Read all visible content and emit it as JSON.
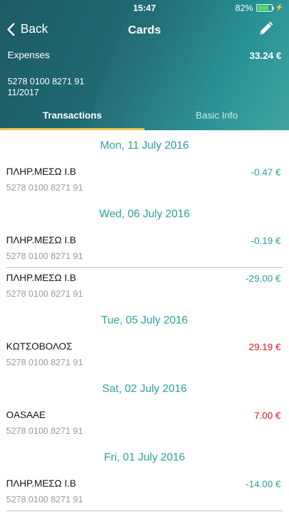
{
  "status": {
    "time": "15:47",
    "battery_pct": "82%",
    "battery_level": 0.82
  },
  "nav": {
    "back_label": "Back",
    "title": "Cards"
  },
  "card": {
    "name": "Expenses",
    "total": "33.24 €",
    "number": "5278 0100 8271 91",
    "expiry": "11/2017"
  },
  "tabs": [
    {
      "label": "Transactions",
      "active": true
    },
    {
      "label": "Basic Info",
      "active": false
    }
  ],
  "groups": [
    {
      "date": "Mon, 11 July 2016",
      "items": [
        {
          "name": "ΠΛΗΡ.ΜΕΣΩ Ι.Β",
          "card": "5278 0100 8271 91",
          "amount": "-0.47 €",
          "type": "debit"
        }
      ]
    },
    {
      "date": "Wed, 06 July 2016",
      "items": [
        {
          "name": "ΠΛΗΡ.ΜΕΣΩ Ι.Β",
          "card": "5278 0100 8271 91",
          "amount": "-0.19 €",
          "type": "debit"
        },
        {
          "name": "ΠΛΗΡ.ΜΕΣΩ Ι.Β",
          "card": "5278 0100 8271 91",
          "amount": "-29.00 €",
          "type": "debit"
        }
      ]
    },
    {
      "date": "Tue, 05 July 2016",
      "items": [
        {
          "name": "ΚΩΤΣΟΒΟΛΟΣ",
          "card": "5278 0100 8271 91",
          "amount": "29.19 €",
          "type": "credit"
        }
      ]
    },
    {
      "date": "Sat, 02 July 2016",
      "items": [
        {
          "name": "OASAAE",
          "card": "5278 0100 8271 91",
          "amount": "7.00 €",
          "type": "credit"
        }
      ]
    },
    {
      "date": "Fri, 01 July 2016",
      "items": [
        {
          "name": "ΠΛΗΡ.ΜΕΣΩ Ι.Β",
          "card": "5278 0100 8271 91",
          "amount": "-14.00 €",
          "type": "debit"
        }
      ]
    }
  ],
  "icons": {
    "back": "chevron-left-icon",
    "edit": "pencil-icon"
  },
  "colors": {
    "accent": "#2aa19b",
    "credit": "#e0121a",
    "tab_indicator": "#f2c94c"
  }
}
